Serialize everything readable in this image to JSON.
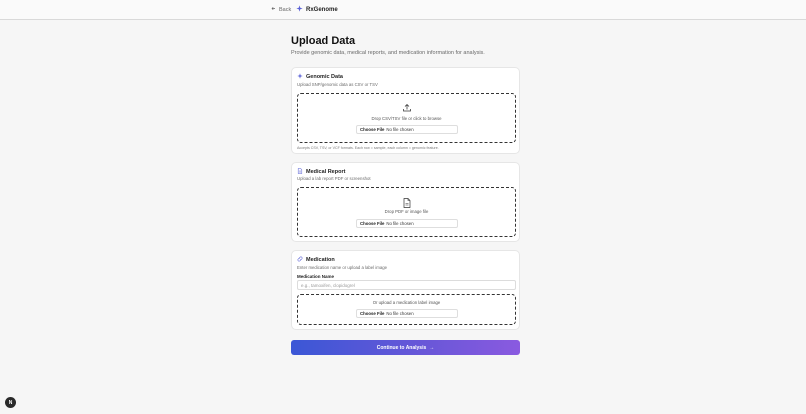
{
  "header": {
    "back_label": "Back",
    "brand_name": "RxGenome"
  },
  "page": {
    "title": "Upload Data",
    "subtitle": "Provide genomic data, medical reports, and medication information for analysis."
  },
  "genomic": {
    "title": "Genomic Data",
    "description": "Upload SNP/genomic data as CSV or TSV",
    "drop_text": "Drop CSV/TSV file or click to browse",
    "choose_label": "Choose File",
    "file_status": "No file chosen",
    "note": "Accepts CSV, TSV, or VCF formats. Each row = sample, each column = genomic feature."
  },
  "medical": {
    "title": "Medical Report",
    "description": "Upload a lab report PDF or screenshot",
    "drop_text": "Drop PDF or image file",
    "choose_label": "Choose File",
    "file_status": "No file chosen"
  },
  "medication": {
    "title": "Medication",
    "description": "Enter medication name or upload a label image",
    "field_label": "Medication Name",
    "input_value": "",
    "input_placeholder": "e.g., tamoxifen, clopidogrel",
    "drop_text": "Or upload a medication label image",
    "choose_label": "Choose File",
    "file_status": "No file chosen"
  },
  "actions": {
    "continue_label": "Continue to Analysis",
    "continue_arrow": "→"
  },
  "help": {
    "label": "N"
  },
  "colors": {
    "accent_start": "#3b57d6",
    "accent_end": "#8a5ae0",
    "brand_icon": "#5b62d6"
  }
}
